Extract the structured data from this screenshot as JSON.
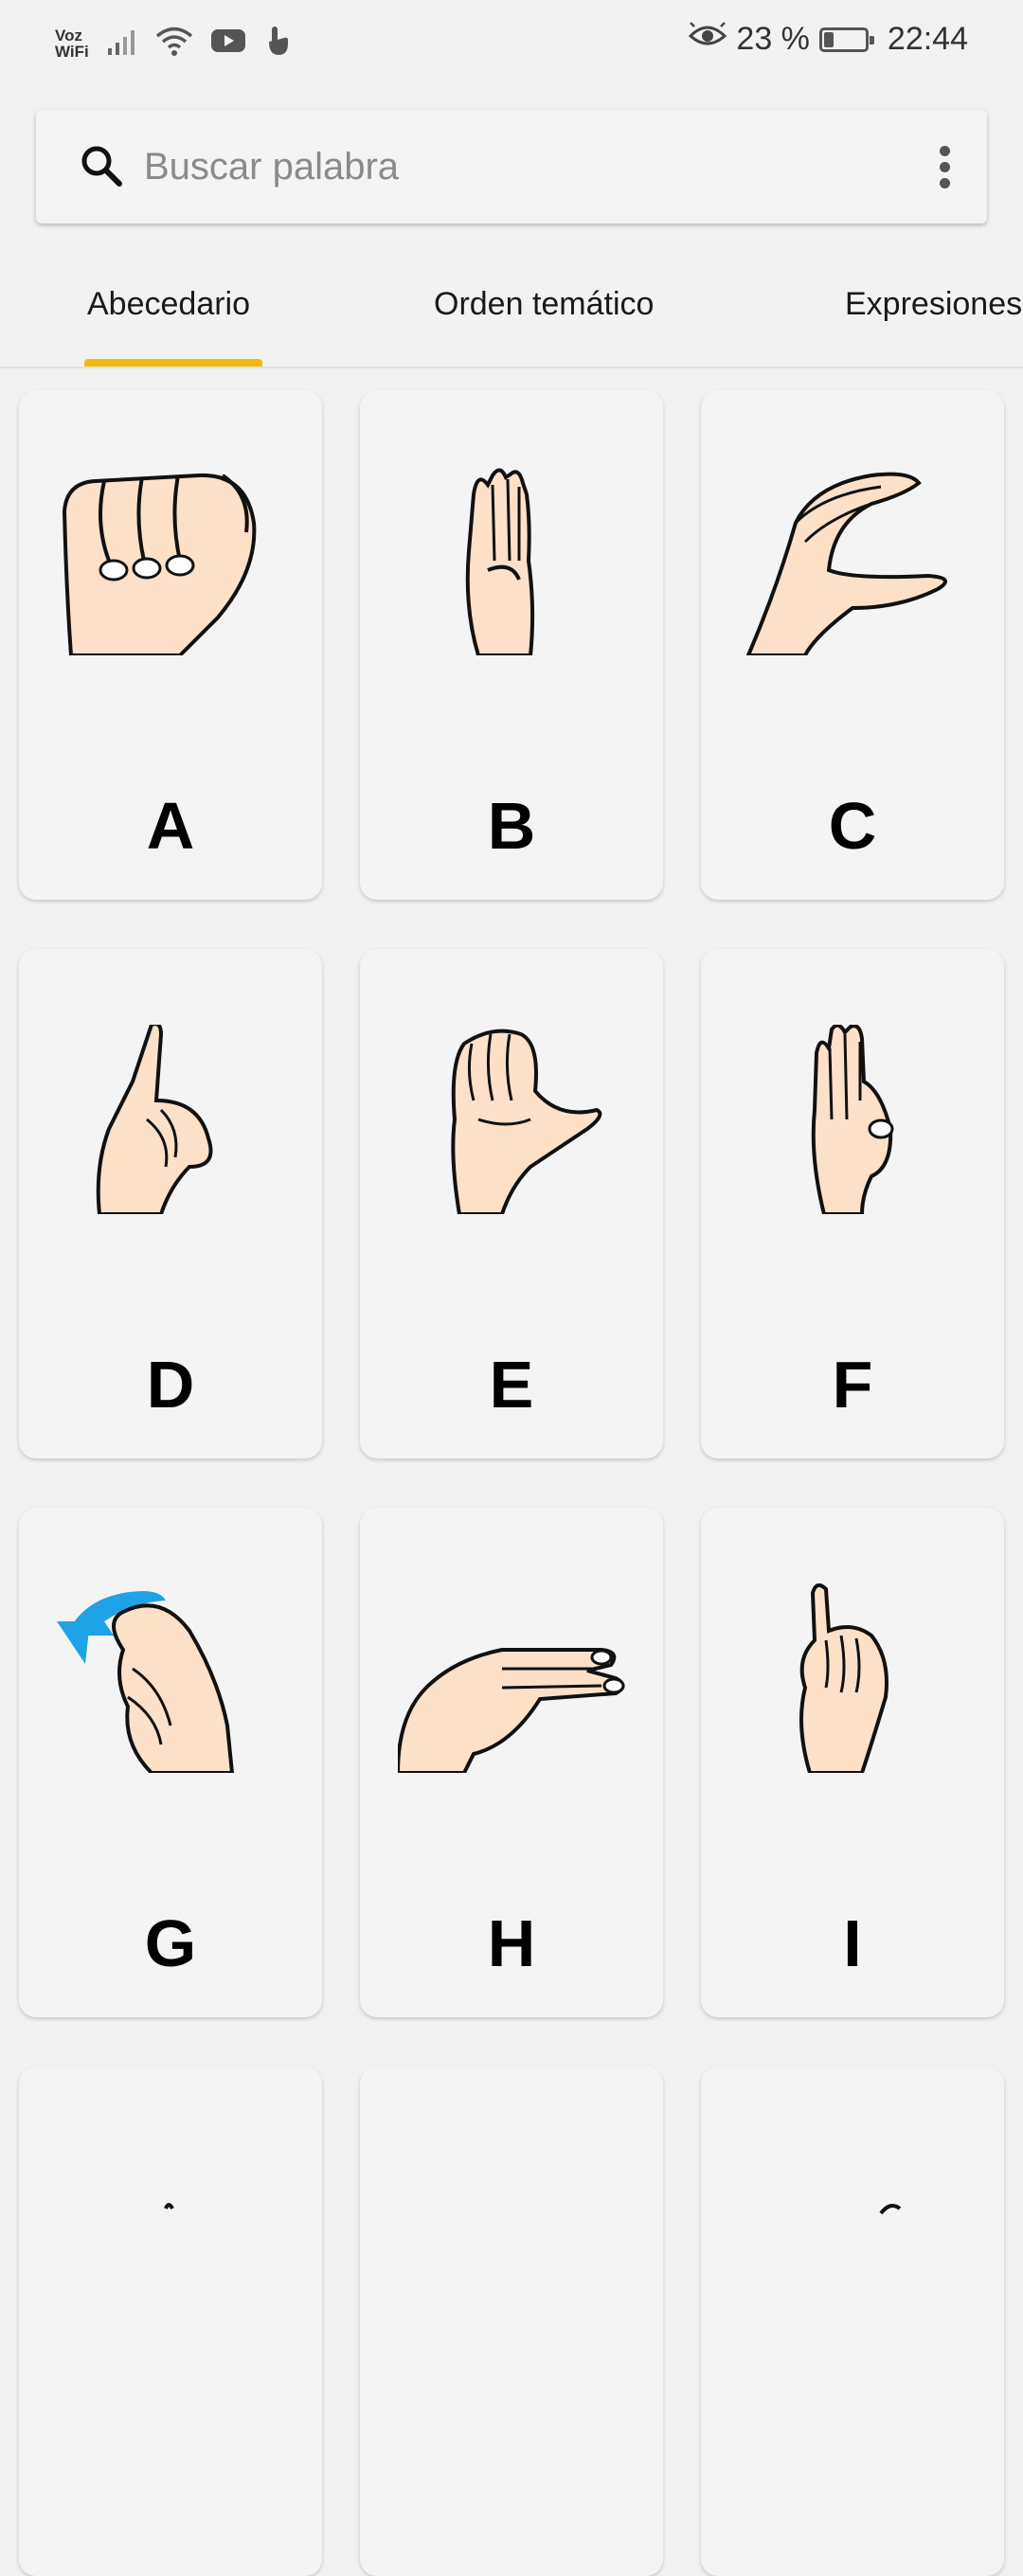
{
  "status_bar": {
    "network_label_1": "Voz",
    "network_label_2": "WiFi",
    "battery_percent_text": "23 %",
    "battery_level": 0.23,
    "time": "22:44",
    "icons": [
      "signal-icon",
      "wifi-icon",
      "youtube-icon",
      "touch-icon",
      "eye-icon",
      "battery-icon"
    ]
  },
  "search": {
    "placeholder": "Buscar palabra",
    "icon": "search-icon",
    "menu_icon": "more-vert-icon"
  },
  "tabs": [
    {
      "label": "Abecedario",
      "selected": true
    },
    {
      "label": "Orden temático",
      "selected": false
    },
    {
      "label": "Expresiones",
      "selected": false
    }
  ],
  "colors": {
    "accent": "#f2b90f",
    "skin": "#fde0c8",
    "arrow": "#1fa3e6"
  },
  "cards": [
    {
      "letter": "A",
      "icon": "hand-sign-a-icon"
    },
    {
      "letter": "B",
      "icon": "hand-sign-b-icon"
    },
    {
      "letter": "C",
      "icon": "hand-sign-c-icon"
    },
    {
      "letter": "D",
      "icon": "hand-sign-d-icon"
    },
    {
      "letter": "E",
      "icon": "hand-sign-e-icon"
    },
    {
      "letter": "F",
      "icon": "hand-sign-f-icon"
    },
    {
      "letter": "G",
      "icon": "hand-sign-g-icon"
    },
    {
      "letter": "H",
      "icon": "hand-sign-h-icon"
    },
    {
      "letter": "I",
      "icon": "hand-sign-i-icon"
    }
  ]
}
